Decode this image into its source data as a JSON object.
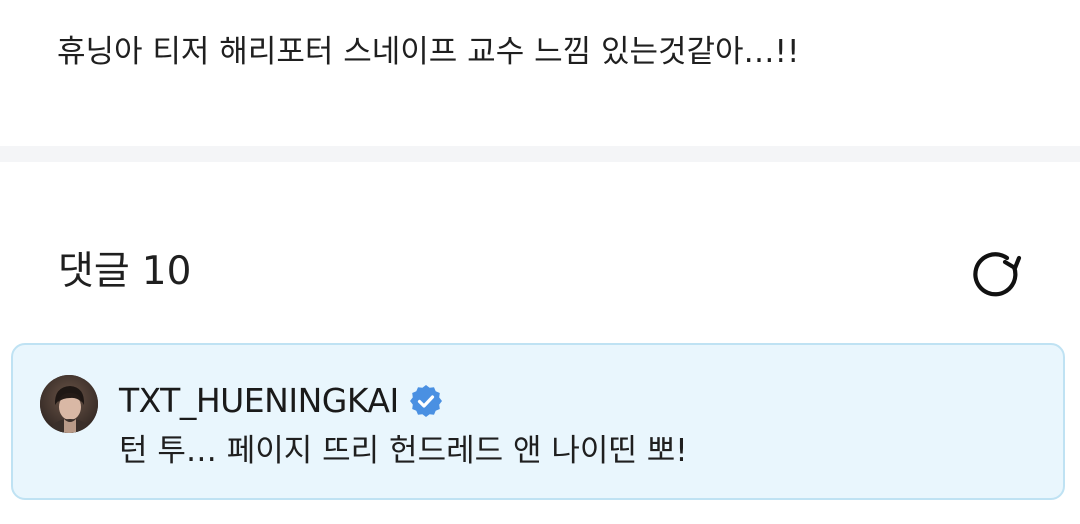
{
  "post": {
    "body": "휴닝아 티저 해리포터 스네이프 교수 느낌 있는것같아…!!"
  },
  "comments": {
    "title": "댓글",
    "count": "10",
    "refresh_icon": "refresh-icon"
  },
  "comment": {
    "author": "TXT_HUENINGKAI",
    "verified_icon": "verified-badge-icon",
    "text": "턴 투… 페이지 뜨리 헌드레드 앤 나이띤 뽀!"
  },
  "colors": {
    "card_background": "#e9f6fd",
    "card_border": "#bfe2f3",
    "verified_blue": "#4a90e2",
    "divider": "#f4f5f7"
  }
}
